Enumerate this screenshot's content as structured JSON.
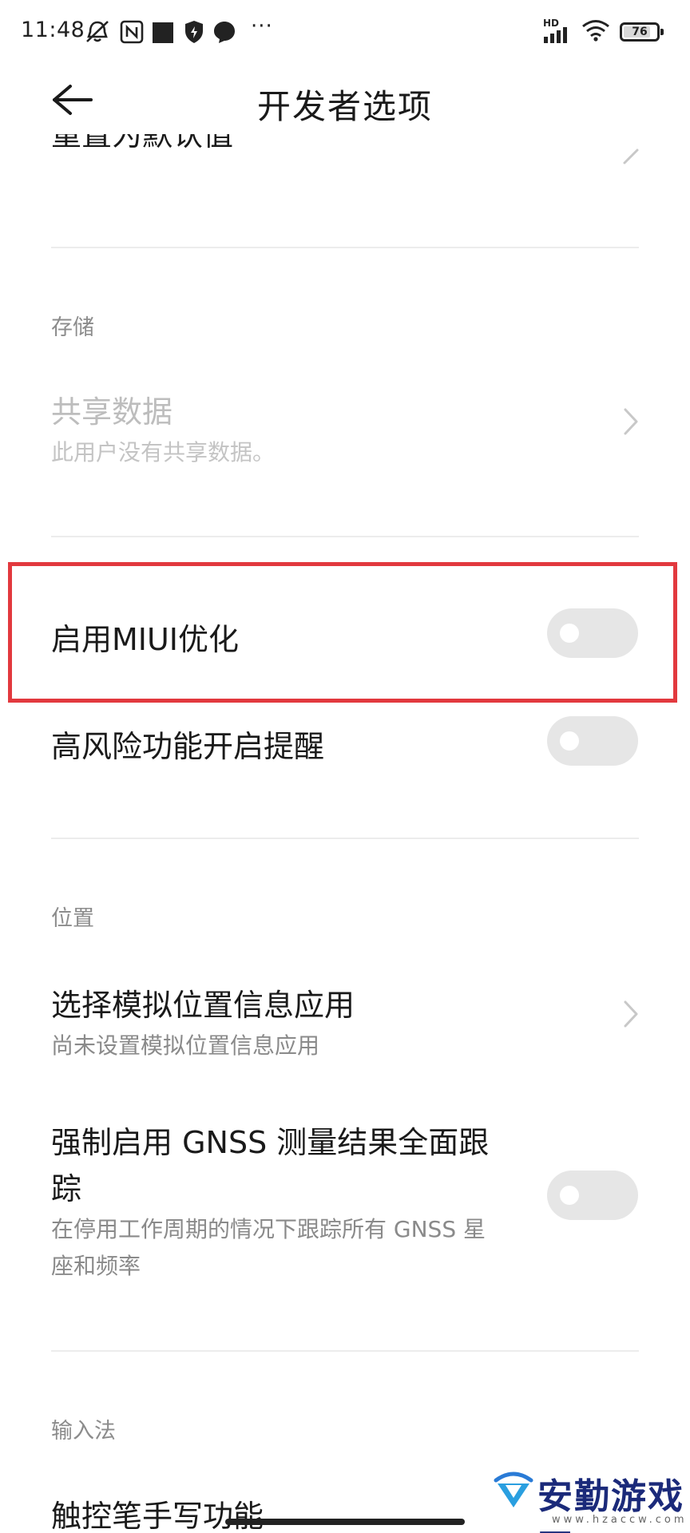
{
  "status_bar": {
    "time": "11:48",
    "network": "HD",
    "battery": "76",
    "battery_level": 0.76,
    "more": "···"
  },
  "header": {
    "title": "开发者选项"
  },
  "cut_item": {
    "label": "重置为默认值"
  },
  "sections": {
    "storage": "存储",
    "location": "位置",
    "input_method": "输入法"
  },
  "items": {
    "shared_data": {
      "title": "共享数据",
      "subtitle": "此用户没有共享数据。",
      "enabled": false
    },
    "miui_opt": {
      "title": "启用MIUI优化",
      "on": false
    },
    "risk_alert": {
      "title": "高风险功能开启提醒",
      "on": false
    },
    "mock_location": {
      "title": "选择模拟位置信息应用",
      "subtitle": "尚未设置模拟位置信息应用"
    },
    "gnss": {
      "title_line1": "强制启用 GNSS 测量结果全面跟",
      "title_line2": "踪",
      "subtitle_line1": "在停用工作周期的情况下跟踪所有 GNSS 星",
      "subtitle_line2": "座和频率",
      "on": false
    },
    "stylus": {
      "title": "触控笔手写功能"
    }
  },
  "watermark": {
    "text": "安勤游戏网",
    "url": "www.hzaccw.com"
  },
  "colors": {
    "highlight": "#e2393e",
    "toggle_off": "#e6e6e6",
    "text_primary": "#1a1a1a",
    "text_secondary": "#8a8a8a"
  }
}
